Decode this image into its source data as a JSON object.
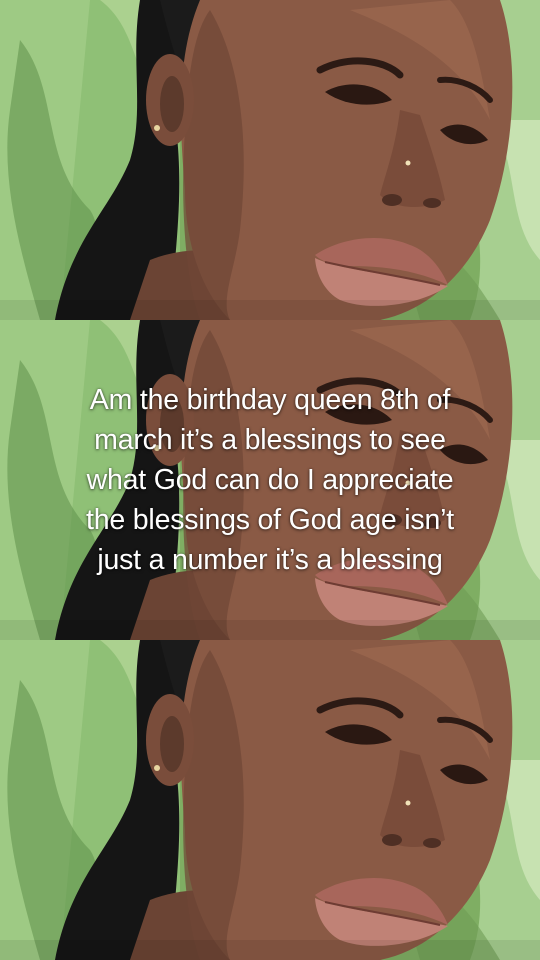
{
  "overlay": {
    "caption_lines": [
      "Am the birthday queen 8th of",
      "march it’s a blessings to see",
      "what God can do I appreciate",
      "the blessings of God age isn’t",
      "just a number it’s a blessing"
    ]
  },
  "colors": {
    "background_leaf": "#7fb56a",
    "skin": "#8a5a45",
    "lips": "#b8756a",
    "hair": "#141414",
    "caption_text": "#ffffff"
  }
}
